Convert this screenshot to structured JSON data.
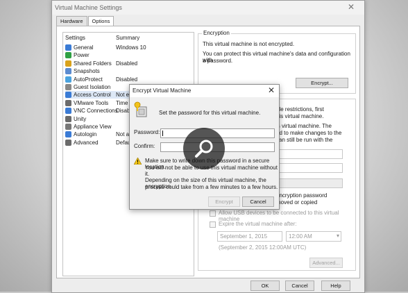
{
  "window": {
    "title": "Virtual Machine Settings",
    "close": "✕"
  },
  "tabs": [
    {
      "label": "Hardware"
    },
    {
      "label": "Options"
    }
  ],
  "list": {
    "headers": {
      "settings": "Settings",
      "summary": "Summary"
    },
    "rows": [
      {
        "name": "General",
        "summary": "Windows 10",
        "icon": "general-icon",
        "color": "#3a7bd5"
      },
      {
        "name": "Power",
        "summary": "",
        "icon": "power-icon",
        "color": "#2ea043"
      },
      {
        "name": "Shared Folders",
        "summary": "Disabled",
        "icon": "shared-folders-icon",
        "color": "#d9a21b"
      },
      {
        "name": "Snapshots",
        "summary": "",
        "icon": "snapshots-icon",
        "color": "#5b8bd0"
      },
      {
        "name": "AutoProtect",
        "summary": "Disabled",
        "icon": "autoprotect-icon",
        "color": "#4aa3df"
      },
      {
        "name": "Guest Isolation",
        "summary": "",
        "icon": "guest-isolation-icon",
        "color": "#888888"
      },
      {
        "name": "Access Control",
        "summary": "Not encr",
        "icon": "access-control-icon",
        "color": "#3a7bd5"
      },
      {
        "name": "VMware Tools",
        "summary": "Time syn",
        "icon": "vmware-tools-icon",
        "color": "#6b6b6b"
      },
      {
        "name": "VNC Connections",
        "summary": "Disabled",
        "icon": "vnc-connections-icon",
        "color": "#3a7bd5"
      },
      {
        "name": "Unity",
        "summary": "",
        "icon": "unity-icon",
        "color": "#6a6a6a"
      },
      {
        "name": "Appliance View",
        "summary": "",
        "icon": "appliance-view-icon",
        "color": "#777777"
      },
      {
        "name": "Autologin",
        "summary": "Not avail",
        "icon": "autologin-icon",
        "color": "#3a7bd5"
      },
      {
        "name": "Advanced",
        "summary": "Default/D",
        "icon": "advanced-icon",
        "color": "#6b6b6b"
      }
    ]
  },
  "encryption": {
    "title": "Encryption",
    "status": "This virtual machine is not encrypted.",
    "desc1": "You can protect this virtual machine's data and configuration with",
    "desc2": "a password.",
    "encrypt_button": "Encrypt..."
  },
  "restrictions": {
    "partial1": "ble restrictions, first",
    "partial2": "his virtual machine.",
    "partial3": "is virtual machine. The",
    "partial4": "ed to make changes to the",
    "partial5": "can still be run with the",
    "partial6": "encryption password",
    "partial7": "moved or copied",
    "usb_label": "Allow USB devices to be connected to this virtual machine",
    "expire_label": "Expire the virtual machine after:",
    "date_value": "September  1, 2015",
    "time_value": "12:00 AM",
    "expire_note": "(September 2, 2015 12:00AM UTC)",
    "advanced_button": "Advanced..."
  },
  "bottom_buttons": {
    "ok": "OK",
    "cancel": "Cancel",
    "help": "Help"
  },
  "dialog": {
    "title": "Encrypt Virtual Machine",
    "close": "✕",
    "header_text": "Set the password for this virtual machine.",
    "password_label": "Password:",
    "confirm_label": "Confirm:",
    "warning1": "Make sure to write down this password in a secure location.",
    "warning2": "You will not be able to use this virtual machine without it.",
    "info1": "Depending on the size of this virtual machine, the encryption",
    "info2": "process could take from a few minutes to a few hours.",
    "encrypt_button": "Encrypt",
    "cancel_button": "Cancel"
  },
  "colors": {
    "accent": "#3a7bd5",
    "overlay": "#141414"
  }
}
